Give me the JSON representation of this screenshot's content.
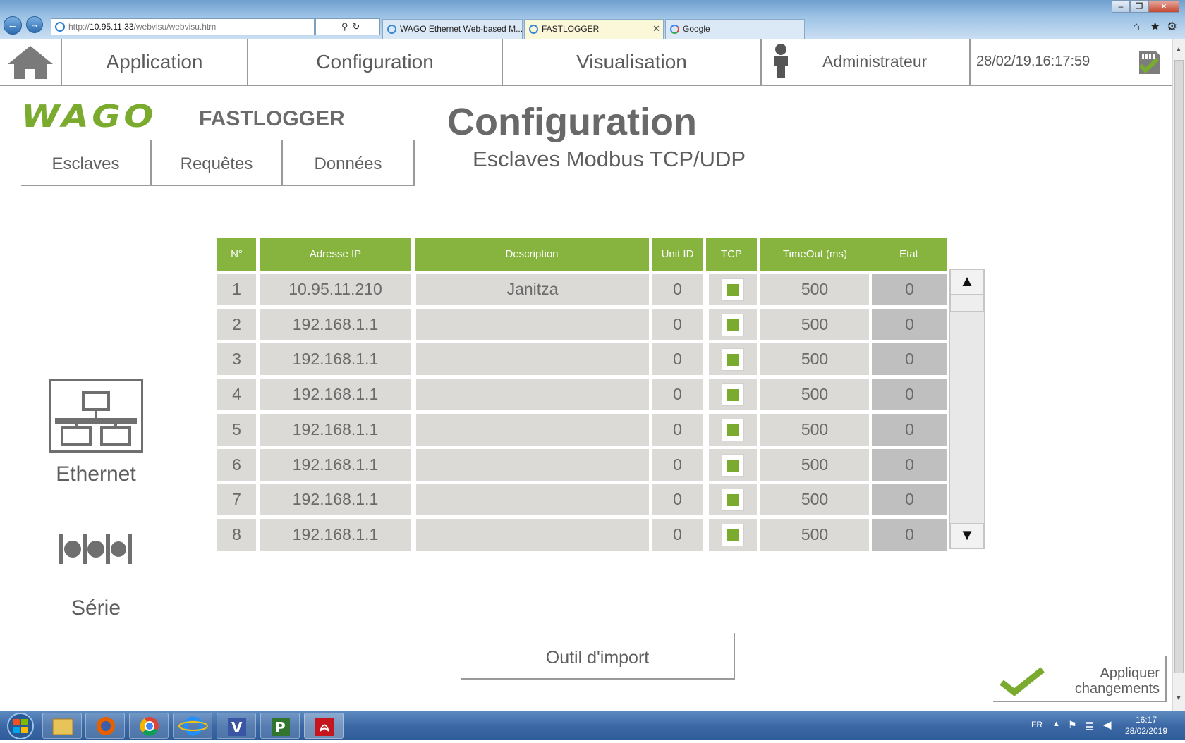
{
  "browser": {
    "address_prefix": "http://",
    "address_host": "10.95.11.33",
    "address_path": "/webvisu/webvisu.htm",
    "tabs": [
      {
        "label": "WAGO Ethernet Web-based M..."
      },
      {
        "label": "FASTLOGGER"
      },
      {
        "label": "Google"
      }
    ]
  },
  "header": {
    "menu": [
      "Application",
      "Configuration",
      "Visualisation"
    ],
    "user": "Administrateur",
    "datetime": "28/02/19,16:17:59"
  },
  "brand": {
    "logo_text": "WAGO",
    "product": "FASTLOGGER"
  },
  "subtabs": [
    "Esclaves",
    "Requêtes",
    "Données"
  ],
  "page": {
    "title": "Configuration",
    "subtitle": "Esclaves Modbus TCP/UDP"
  },
  "sidebar": {
    "ethernet_label": "Ethernet",
    "serie_label": "Série"
  },
  "table": {
    "headers": [
      "N°",
      "Adresse IP",
      "Description",
      "Unit ID",
      "TCP",
      "TimeOut (ms)",
      "Etat"
    ],
    "rows": [
      {
        "n": "1",
        "ip": "10.95.11.210",
        "desc": "Janitza",
        "unit": "0",
        "tcp": true,
        "timeout": "500",
        "etat": "0"
      },
      {
        "n": "2",
        "ip": "192.168.1.1",
        "desc": "",
        "unit": "0",
        "tcp": true,
        "timeout": "500",
        "etat": "0"
      },
      {
        "n": "3",
        "ip": "192.168.1.1",
        "desc": "",
        "unit": "0",
        "tcp": true,
        "timeout": "500",
        "etat": "0"
      },
      {
        "n": "4",
        "ip": "192.168.1.1",
        "desc": "",
        "unit": "0",
        "tcp": true,
        "timeout": "500",
        "etat": "0"
      },
      {
        "n": "5",
        "ip": "192.168.1.1",
        "desc": "",
        "unit": "0",
        "tcp": true,
        "timeout": "500",
        "etat": "0"
      },
      {
        "n": "6",
        "ip": "192.168.1.1",
        "desc": "",
        "unit": "0",
        "tcp": true,
        "timeout": "500",
        "etat": "0"
      },
      {
        "n": "7",
        "ip": "192.168.1.1",
        "desc": "",
        "unit": "0",
        "tcp": true,
        "timeout": "500",
        "etat": "0"
      },
      {
        "n": "8",
        "ip": "192.168.1.1",
        "desc": "",
        "unit": "0",
        "tcp": true,
        "timeout": "500",
        "etat": "0"
      }
    ]
  },
  "buttons": {
    "import": "Outil d'import",
    "apply_line1": "Appliquer",
    "apply_line2": "changements"
  },
  "taskbar": {
    "lang": "FR",
    "time": "16:17",
    "date": "28/02/2019"
  },
  "colors": {
    "accent_green": "#86b43f",
    "check_green": "#7aab2e",
    "text_gray": "#5e5e5e"
  }
}
